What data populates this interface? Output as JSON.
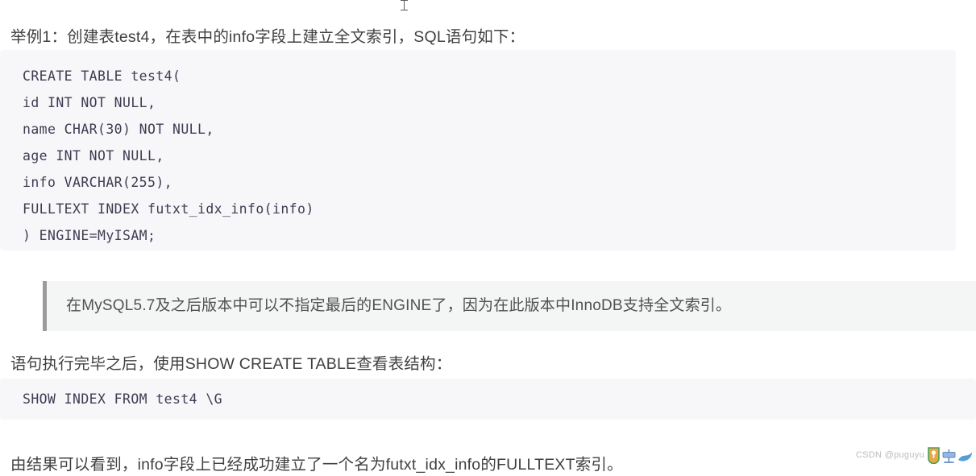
{
  "article": {
    "intro_paragraph": "举例1：创建表test4，在表中的info字段上建立全文索引，SQL语句如下：",
    "middle_paragraph": "语句执行完毕之后，使用SHOW CREATE TABLE查看表结构：",
    "result_paragraph": "由结果可以看到，info字段上已经成功建立了一个名为futxt_idx_info的FULLTEXT索引。",
    "note_quote": "在MySQL5.7及之后版本中可以不指定最后的ENGINE了，因为在此版本中InnoDB支持全文索引。"
  },
  "code_blocks": {
    "create_table": "CREATE TABLE test4(\nid INT NOT NULL,\nname CHAR(30) NOT NULL,\nage INT NOT NULL,\ninfo VARCHAR(255),\nFULLTEXT INDEX futxt_idx_info(info)\n) ENGINE=MyISAM;",
    "show_index": "SHOW INDEX FROM test4 \\G"
  },
  "watermark": {
    "text": "CSDN @puguyu"
  },
  "colors": {
    "page_background": "#ffffff",
    "body_text": "#404040",
    "code_background": "#f7f7f9",
    "code_text": "#413b52",
    "quote_background": "#f4f5f5",
    "quote_border": "#9b9b9b",
    "quote_text": "#515151",
    "watermark_text": "#b9b9b9"
  }
}
